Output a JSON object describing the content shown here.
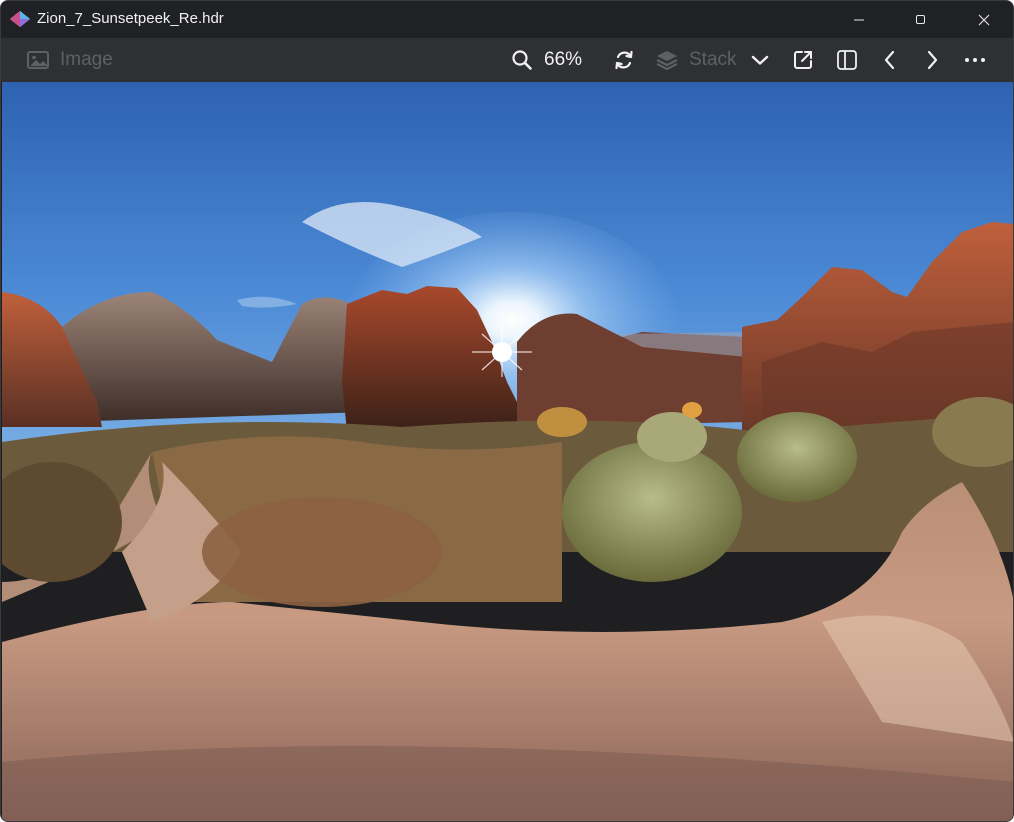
{
  "window": {
    "title": "Zion_7_Sunsetpeek_Re.hdr",
    "controls": {
      "minimize": "minimize-icon",
      "maximize": "maximize-icon",
      "close": "close-icon"
    }
  },
  "toolbar": {
    "image_label": "Image",
    "zoom_value": "66%",
    "stack_label": "Stack",
    "icons": [
      "image-icon",
      "zoom-icon",
      "rotate-icon",
      "layers-icon",
      "chevron-down-icon",
      "open-external-icon",
      "panel-toggle-icon",
      "chevron-left-icon",
      "chevron-right-icon",
      "more-icon"
    ]
  },
  "colors": {
    "titlebar_bg": "#202124",
    "toolbar_bg": "#2f3033",
    "text_primary": "#f1f1f1",
    "text_disabled": "#5f6064"
  }
}
